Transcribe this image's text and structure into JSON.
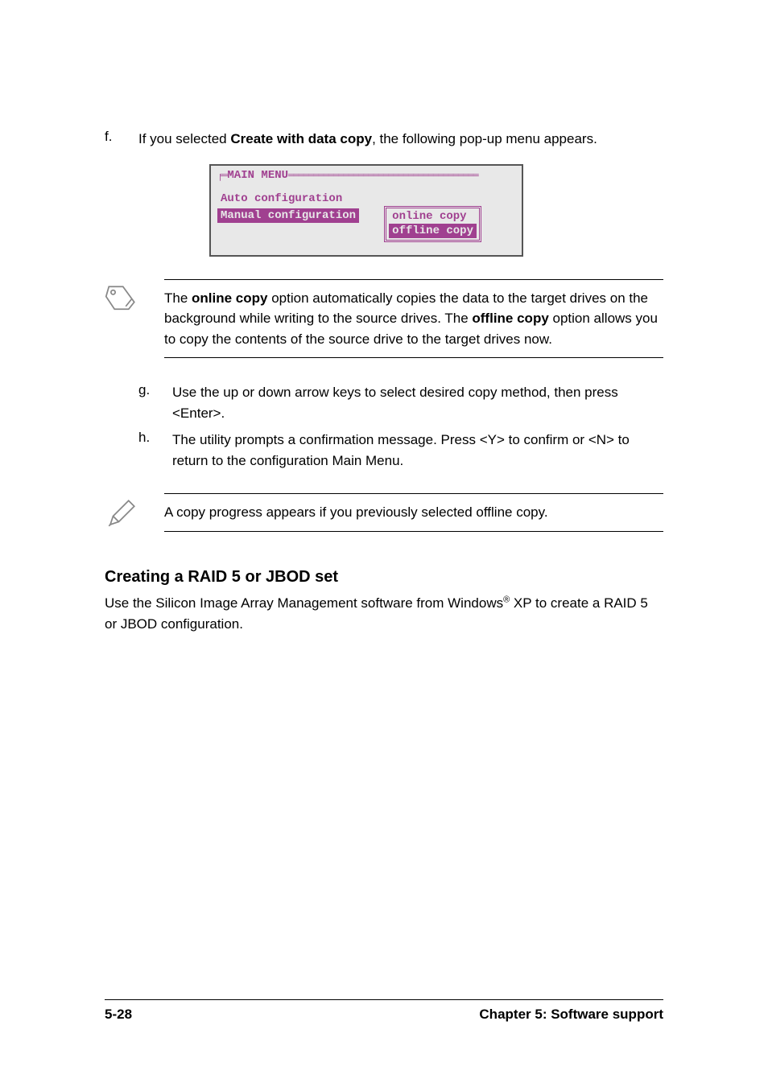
{
  "step_f": {
    "marker": "f.",
    "prefix": "If you selected ",
    "bold": "Create with data copy",
    "suffix": ", the following pop-up menu appears."
  },
  "menu": {
    "title": "MAIN MENU",
    "item_auto": "Auto configuration",
    "item_manual": "Manual configuration",
    "sub_online": "online copy",
    "sub_offline": "offline copy"
  },
  "note1": {
    "seg1": "The ",
    "bold1": "online copy",
    "seg2": " option automatically copies the data to the target drives on the background while writing to the source drives. The ",
    "bold2": "offline copy",
    "seg3": " option allows you to copy the contents of the source drive to the target drives now."
  },
  "step_g": {
    "marker": "g.",
    "text": "Use the up or down arrow keys to select desired copy method, then press <Enter>."
  },
  "step_h": {
    "marker": "h.",
    "text": "The utility prompts a confirmation message. Press <Y> to confirm or <N> to return to the configuration Main Menu."
  },
  "note2": {
    "text": "A copy progress appears if you previously selected offline copy."
  },
  "section": {
    "heading": "Creating a RAID 5 or JBOD set",
    "body_prefix": "Use the Silicon Image Array Management software from Windows",
    "sup": "®",
    "body_suffix": " XP to create a RAID 5 or JBOD configuration."
  },
  "footer": {
    "left": "5-28",
    "right": "Chapter 5: Software support"
  }
}
